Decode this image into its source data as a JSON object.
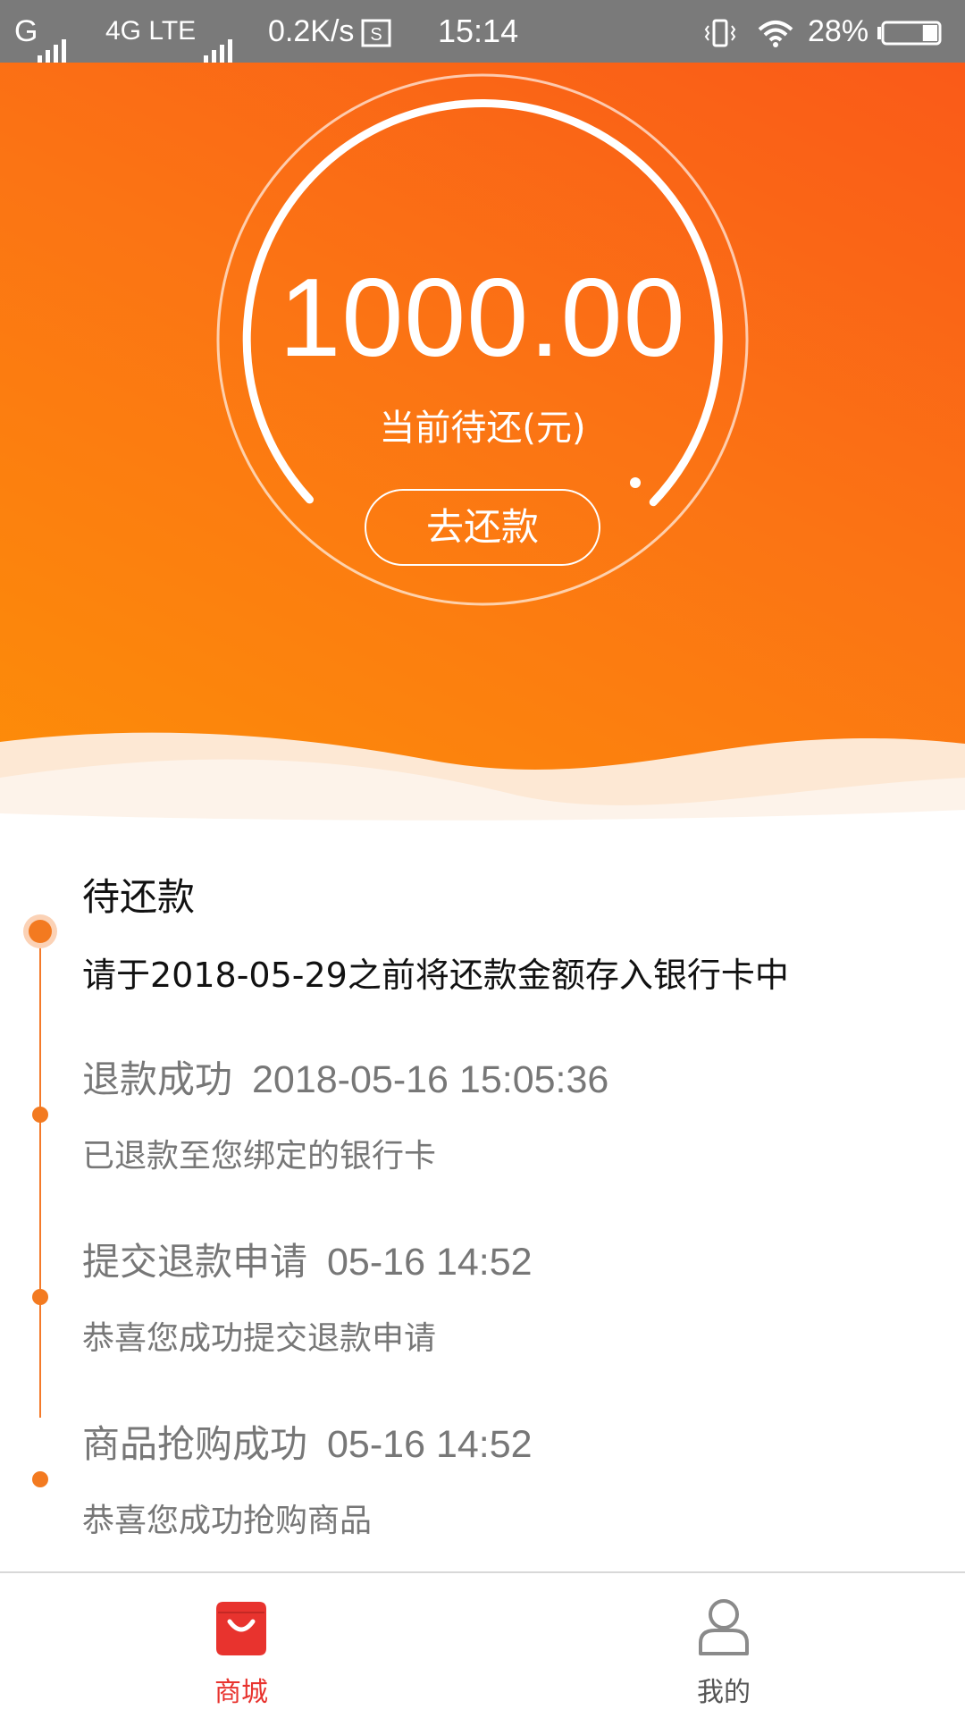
{
  "status_bar": {
    "carrier1": "G",
    "network": "4G LTE",
    "speed": "0.2K/s",
    "time": "15:14",
    "battery": "28%",
    "battery_level": 0.28
  },
  "hero": {
    "amount": "1000.00",
    "amount_label": "当前待还(元)",
    "repay_button": "去还款"
  },
  "timeline": {
    "items": [
      {
        "title": "待还款",
        "time": "",
        "desc": "请于2018-05-29之前将还款金额存入银行卡中"
      },
      {
        "title": "退款成功",
        "time": "2018-05-16 15:05:36",
        "desc": "已退款至您绑定的银行卡"
      },
      {
        "title": "提交退款申请",
        "time": "05-16 14:52",
        "desc": "恭喜您成功提交退款申请"
      },
      {
        "title": "商品抢购成功",
        "time": "05-16 14:52",
        "desc": "恭喜您成功抢购商品"
      }
    ]
  },
  "bottom_nav": {
    "items": [
      {
        "label": "商城",
        "icon": "shopping-bag-icon",
        "active": true
      },
      {
        "label": "我的",
        "icon": "user-icon",
        "active": false
      }
    ]
  },
  "colors": {
    "accent": "#f37a20",
    "active_tab": "#e8332e",
    "status_bar": "#7a7a7a"
  }
}
